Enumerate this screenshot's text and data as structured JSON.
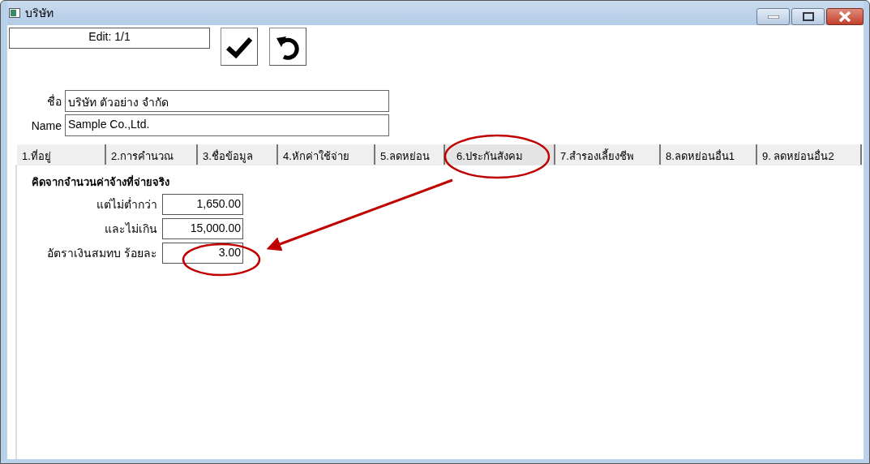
{
  "window": {
    "title": "บริษัท"
  },
  "record_indicator": "Edit: 1/1",
  "company": [
    {
      "label": "ชื่อ",
      "value": "บริษัท ตัวอย่าง จำกัด"
    },
    {
      "label": "Name",
      "value": "Sample Co.,Ltd."
    }
  ],
  "tabs": [
    {
      "label": "1.ที่อยู่",
      "selected": false
    },
    {
      "label": "2.การคำนวณ",
      "selected": false
    },
    {
      "label": "3.ชื่อข้อมูล",
      "selected": false
    },
    {
      "label": "4.หักค่าใช้จ่าย",
      "selected": false
    },
    {
      "label": "5.ลดหย่อน",
      "selected": false
    },
    {
      "label": "6.ประกันสังคม",
      "selected": true
    },
    {
      "label": "7.สำรองเลี้ยงชีพ",
      "selected": false
    },
    {
      "label": "8.ลดหย่อนอื่น1",
      "selected": false
    },
    {
      "label": "9. ลดหย่อนอื่น2",
      "selected": false
    }
  ],
  "panel": {
    "heading": "คิดจากจำนวนค่าจ้างที่จ่ายจริง",
    "fields": [
      {
        "label": "แต่ไม่ต่ำกว่า",
        "value": "1,650.00"
      },
      {
        "label": "และไม่เกิน",
        "value": "15,000.00"
      },
      {
        "label": "อัตราเงินสมทบ ร้อยละ",
        "value": "3.00"
      }
    ]
  }
}
